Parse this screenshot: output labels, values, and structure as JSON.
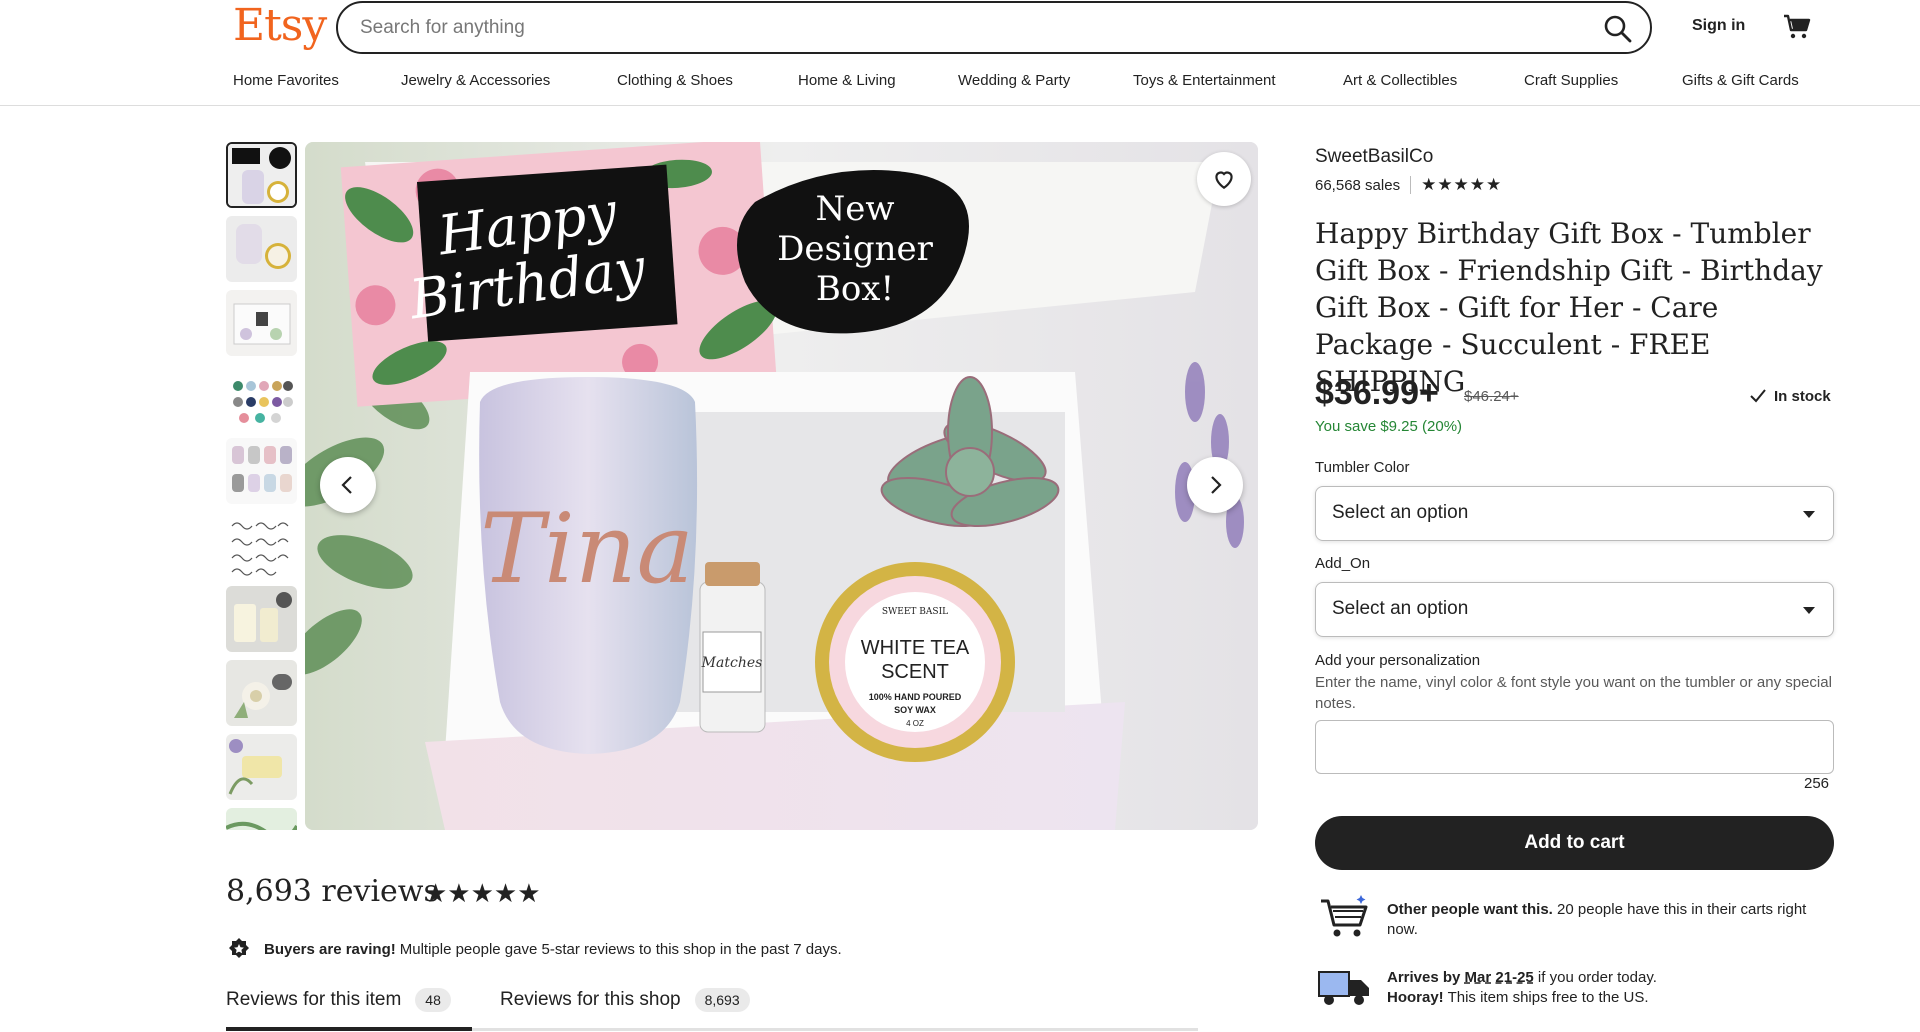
{
  "header": {
    "logo": "Etsy",
    "search_placeholder": "Search for anything",
    "signin_label": "Sign in"
  },
  "nav": [
    "Home Favorites",
    "Jewelry & Accessories",
    "Clothing & Shoes",
    "Home & Living",
    "Wedding & Party",
    "Toys & Entertainment",
    "Art & Collectibles",
    "Craft Supplies",
    "Gifts & Gift Cards"
  ],
  "image": {
    "card_text_line1": "Happy",
    "card_text_line2": "Birthday",
    "badge_line1": "New",
    "badge_line2": "Designer",
    "badge_line3": "Box!",
    "tumbler_name": "Tina",
    "candle_brand": "SWEET BASIL",
    "candle_line1": "WHITE TEA",
    "candle_line2": "SCENT",
    "candle_line3": "100% HAND POURED",
    "candle_line4": "SOY WAX",
    "candle_line5": "4 OZ",
    "matches_label": "Matches"
  },
  "product": {
    "shop_name": "SweetBasilCo",
    "sales": "66,568 sales",
    "shop_stars": "★★★★★",
    "title": "Happy Birthday Gift Box - Tumbler Gift Box - Friendship Gift - Birthday Gift Box - Gift for Her - Care Package - Succulent - FREE SHIPPING",
    "price": "$36.99+",
    "old_price": "$46.24+",
    "stock": "In stock",
    "savings": "You save $9.25 (20%)",
    "option1_label": "Tumbler Color",
    "option1_value": "Select an option",
    "option2_label": "Add_On",
    "option2_value": "Select an option",
    "personalization_label": "Add your personalization",
    "personalization_hint": "Enter the name, vinyl color & font style you want on the tumbler or any special notes.",
    "char_count": "256",
    "add_to_cart": "Add to cart",
    "demand_bold": "Other people want this.",
    "demand_text": " 20 people have this in their carts right now.",
    "arrives_bold": "Arrives by",
    "arrives_date": "Mar 21-25",
    "arrives_text": " if you order today.",
    "hooray_bold": "Hooray!",
    "hooray_text": " This item ships free to the US."
  },
  "reviews": {
    "title": "8,693 reviews",
    "stars": "★★★★★",
    "raving_bold": "Buyers are raving!",
    "raving_text": "Multiple people gave 5-star reviews to this shop in the past 7 days.",
    "tab1_label": "Reviews for this item",
    "tab1_count": "48",
    "tab2_label": "Reviews for this shop",
    "tab2_count": "8,693"
  },
  "colors": {
    "brand": "#f1641e",
    "savings": "#258635",
    "button": "#222222"
  }
}
